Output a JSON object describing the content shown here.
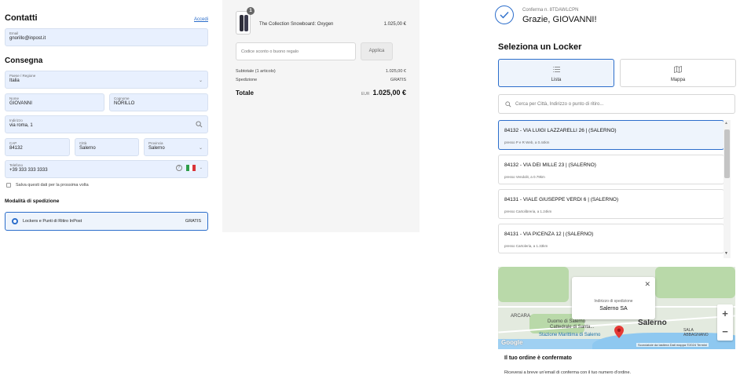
{
  "contact": {
    "title": "Contatti",
    "login_link": "Accedi",
    "email_label": "Email",
    "email_value": "gnorillo@inpost.it"
  },
  "delivery": {
    "title": "Consegna",
    "country_label": "Paese / Regione",
    "country_value": "Italia",
    "first_name_label": "Nome",
    "first_name_value": "GIOVANNI",
    "last_name_label": "Cognome",
    "last_name_value": "NORILLO",
    "address_label": "Indirizzo",
    "address_value": "via roma, 1",
    "zip_label": "CAP",
    "zip_value": "84132",
    "city_label": "Città",
    "city_value": "Salerno",
    "province_label": "Provincia",
    "province_value": "Salerno",
    "phone_label": "Telefono",
    "phone_value": "+39 333 333 3333",
    "save_info_label": "Salva questi dati per la prossima volta"
  },
  "shipping": {
    "title": "Modalità di spedizione",
    "option_label": "Lockers e Punti di Ritiro InPost",
    "option_price": "GRATIS"
  },
  "summary": {
    "badge_count": "1",
    "product_name": "The Collection Snowboard: Oxygen",
    "product_price": "1.025,00 €",
    "coupon_placeholder": "Codice sconto o buono regalo",
    "apply_label": "Applica",
    "subtotal_label": "Subtotale (1 articolo)",
    "subtotal_value": "1.025,00 €",
    "shipping_label": "Spedizione",
    "shipping_value": "GRATIS",
    "total_label": "Totale",
    "total_currency": "EUR",
    "total_value": "1.025,00 €"
  },
  "confirmation": {
    "order_number": "Conferma n. 8TDAWLCPN",
    "thanks": "Grazie, GIOVANNI!"
  },
  "locker": {
    "title": "Seleziona un Locker",
    "tab_list": "Lista",
    "tab_map": "Mappa",
    "search_placeholder": "Cerca per Città, Indirizzo o punto di ritiro...",
    "items": [
      {
        "title": "84132 - VIA LUIGI LAZZARELLI 26 | (SALERNO)",
        "sub": "presso P e R Web, a 0.44km"
      },
      {
        "title": "84132 - VIA DEI MILLE 23 | (SALERNO)",
        "sub": "presso Vendolit, a 0.79km"
      },
      {
        "title": "84131 - VIALE GIUSEPPE VERDI 6 | (SALERNO)",
        "sub": "presso Cartolibreria, a 1.24km"
      },
      {
        "title": "84131 - VIA PICENZA 12 | (SALERNO)",
        "sub": "presso Cartoleria, a 1.33km"
      }
    ]
  },
  "map": {
    "tooltip_label": "Indirizzo di spedizione",
    "tooltip_value": "Salerno SA",
    "city_label": "Salerno",
    "place_1": "ARCARA",
    "place_2": "SALA ABBAGNANO",
    "place_3": "Duomo di Salerno",
    "place_4": "Cattedrale di Santa...",
    "place_5": "Stazione Marittima di Salerno",
    "zoom_in": "+",
    "zoom_out": "−",
    "google": "Google",
    "attribution": "Scorciatoie da tastiera   Dati mappa ©2024   Termini"
  },
  "confirmed": {
    "title": "Il tuo ordine è confermato",
    "text": "Riceverai a breve un'email di conferma con il tuo numero d'ordine."
  },
  "colors": {
    "accent": "#2c6ecb",
    "field_bg": "#e8f0fe",
    "summary_bg": "#f5f5f5",
    "pin": "#e53935"
  },
  "icons": {
    "check": "check-icon",
    "search": "search-icon",
    "list": "list-icon",
    "map": "map-icon"
  }
}
